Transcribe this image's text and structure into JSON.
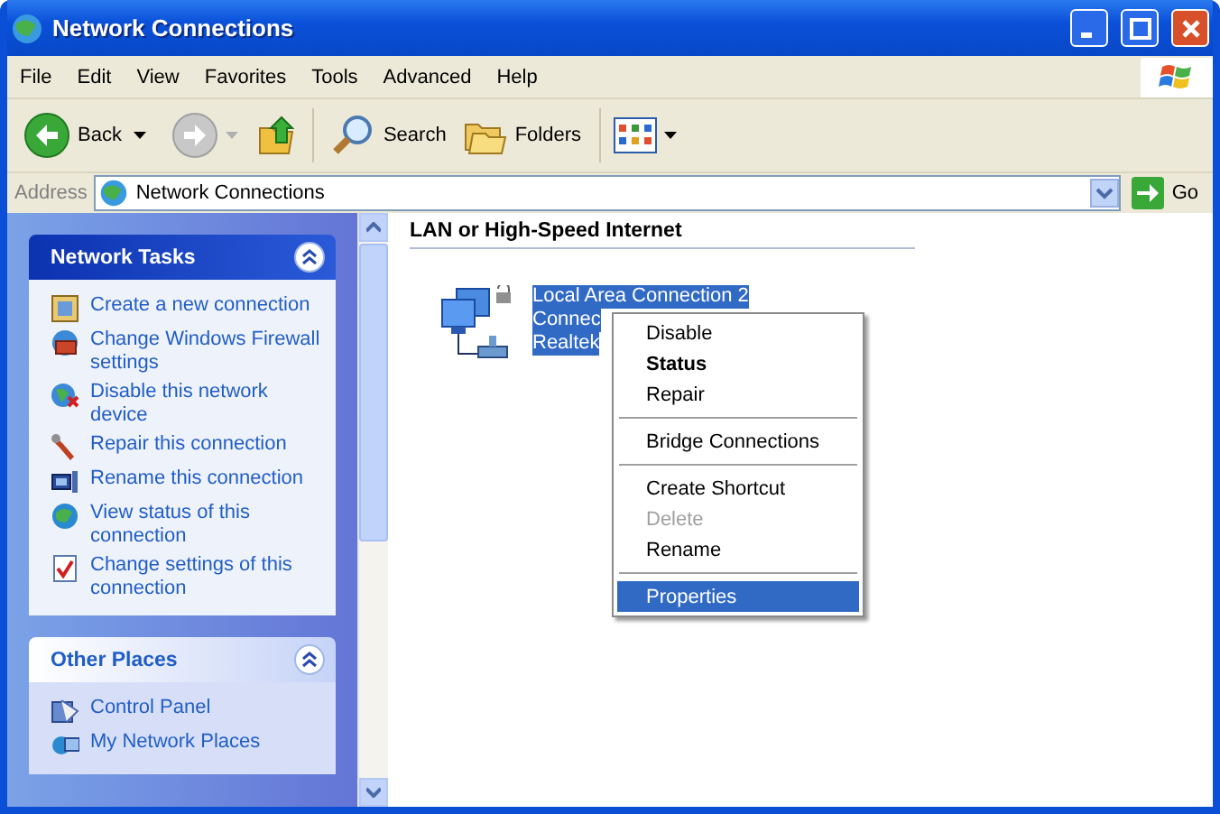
{
  "window": {
    "title": "Network Connections"
  },
  "menu_bar": [
    "File",
    "Edit",
    "View",
    "Favorites",
    "Tools",
    "Advanced",
    "Help"
  ],
  "toolbar": {
    "back": "Back",
    "search": "Search",
    "folders": "Folders"
  },
  "address_bar": {
    "label": "Address",
    "value": "Network Connections",
    "go": "Go"
  },
  "task_panels": [
    {
      "title": "Network Tasks",
      "kind": "special",
      "expanded": true,
      "items": [
        "Create a new connection",
        "Change Windows Firewall settings",
        "Disable this network device",
        "Repair this connection",
        "Rename this connection",
        "View status of this connection",
        "Change settings of this connection"
      ]
    },
    {
      "title": "Other Places",
      "kind": "normal",
      "expanded": true,
      "items": [
        "Control Panel",
        "My Network Places"
      ]
    }
  ],
  "content": {
    "group_header": "LAN or High-Speed Internet",
    "connections": [
      {
        "lines": [
          "Local Area Connection 2",
          "Connec",
          "Realtek"
        ],
        "selected": true
      }
    ]
  },
  "context_menu": [
    {
      "kind": "item",
      "label": "Disable",
      "bold": false,
      "disabled": false,
      "selected": false
    },
    {
      "kind": "item",
      "label": "Status",
      "bold": true,
      "disabled": false,
      "selected": false
    },
    {
      "kind": "item",
      "label": "Repair",
      "bold": false,
      "disabled": false,
      "selected": false
    },
    {
      "kind": "separator"
    },
    {
      "kind": "item",
      "label": "Bridge Connections",
      "bold": false,
      "disabled": false,
      "selected": false
    },
    {
      "kind": "separator"
    },
    {
      "kind": "item",
      "label": "Create Shortcut",
      "bold": false,
      "disabled": false,
      "selected": false
    },
    {
      "kind": "item",
      "label": "Delete",
      "bold": false,
      "disabled": true,
      "selected": false
    },
    {
      "kind": "item",
      "label": "Rename",
      "bold": false,
      "disabled": false,
      "selected": false
    },
    {
      "kind": "separator"
    },
    {
      "kind": "item",
      "label": "Properties",
      "bold": false,
      "disabled": false,
      "selected": true
    }
  ]
}
